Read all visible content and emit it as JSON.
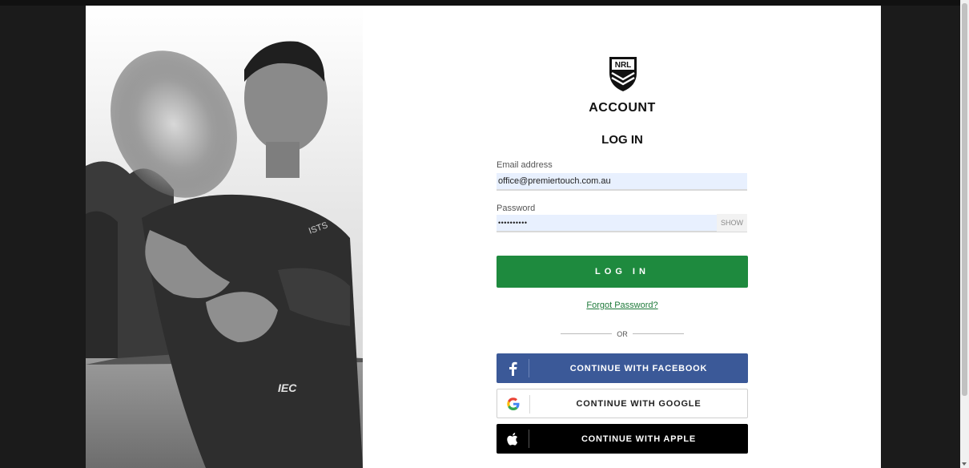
{
  "brand": {
    "logo_text": "NRL",
    "title": "ACCOUNT"
  },
  "login": {
    "heading": "LOG IN",
    "email_label": "Email address",
    "email_value": "office@premiertouch.com.au",
    "password_label": "Password",
    "password_value": "••••••••••",
    "show_label": "SHOW",
    "submit_label": "LOG IN",
    "forgot_label": "Forgot Password?",
    "or_label": "OR"
  },
  "social": {
    "facebook_label": "CONTINUE WITH FACEBOOK",
    "google_label": "CONTINUE WITH GOOGLE",
    "apple_label": "CONTINUE WITH APPLE"
  },
  "colors": {
    "primary_green": "#1e8a3e",
    "facebook_blue": "#3b5998",
    "apple_black": "#000000",
    "input_bg": "#e8f0fe"
  }
}
